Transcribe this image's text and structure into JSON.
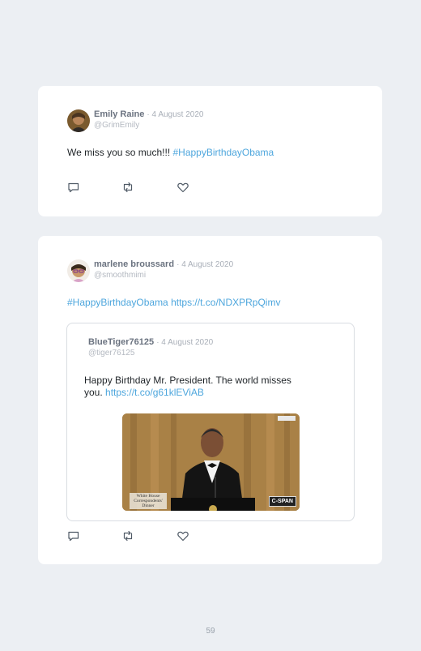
{
  "tweets": [
    {
      "author": "Emily Raine",
      "date": "· 4 August 2020",
      "handle": "@GrimEmily",
      "text": "We miss you so much!!! ",
      "hashtag": "#HappyBirthdayObama"
    },
    {
      "author": "marlene broussard",
      "date": "· 4 August 2020",
      "handle": "@smoothmimi",
      "hashtag": "#HappyBirthdayObama",
      "link": "https://t.co/NDXPRpQimv",
      "quoted": {
        "author": "BlueTiger76125",
        "date": "· 4 August 2020",
        "handle": "@tiger76125",
        "text_line1": "Happy Birthday Mr. President. The world misses",
        "text_line2": "you. ",
        "link": "https://t.co/g61klEViAB",
        "media": {
          "overlay_top_right": "",
          "overlay_bottom_left_line1": "White House",
          "overlay_bottom_left_line2": "Correspondents'",
          "overlay_bottom_left_line3": "Dinner",
          "network_logo": "C-SPAN"
        }
      }
    }
  ],
  "icons": [
    "reply-icon",
    "retweet-icon",
    "like-icon"
  ],
  "colors": {
    "link": "#4da6dd",
    "background": "#eceff3",
    "card": "#ffffff"
  },
  "page_number": "59"
}
